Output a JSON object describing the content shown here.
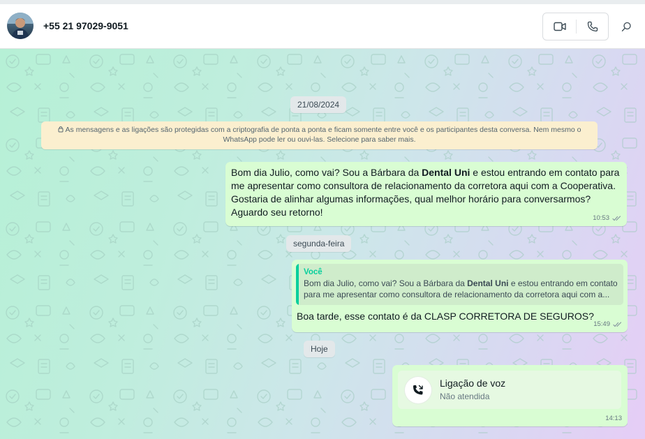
{
  "header": {
    "contact_name": "+55 21 97029-9051",
    "icons": {
      "video": "video-camera-icon",
      "voice": "phone-icon",
      "search": "search-icon"
    }
  },
  "chat": {
    "date_chips": [
      "21/08/2024",
      "segunda-feira",
      "Hoje"
    ],
    "encryption_notice": {
      "line1": "As mensagens e as ligações são protegidas com a criptografia de ponta a ponta e ficam somente entre você e os participantes desta conversa. Nem mesmo o",
      "line2": "WhatsApp pode ler ou ouvi-las. Selecione para saber mais."
    },
    "messages": [
      {
        "text_before": "Bom dia Julio, como vai? Sou a Bárbara da ",
        "text_bold": "Dental Uni",
        "text_after": " e estou entrando em contato para me apresentar como consultora de relacionamento da corretora aqui com a Cooperativa. Gostaria de alinhar algumas informações, qual melhor horário para conversarmos? Aguardo seu retorno!",
        "time": "10:53",
        "status": "double-check-icon"
      },
      {
        "quote_author": "Você",
        "quote_before": "Bom dia Julio, como vai? Sou a Bárbara da ",
        "quote_bold": "Dental Uni",
        "quote_after": " e estou entrando em contato para me apresentar como consultora de relacionamento da corretora aqui com a...",
        "text": "Boa tarde, esse contato é da CLASP CORRETORA DE SEGUROS?",
        "time": "15:49",
        "status": "double-check-icon"
      },
      {
        "call_title": "Ligação de voz",
        "call_status": "Não atendida",
        "time": "14:13"
      }
    ]
  },
  "colors": {
    "bubble_outgoing": "#d9fdd3",
    "accent_green": "#06cf9c",
    "notice_bg": "#fbefcf"
  }
}
